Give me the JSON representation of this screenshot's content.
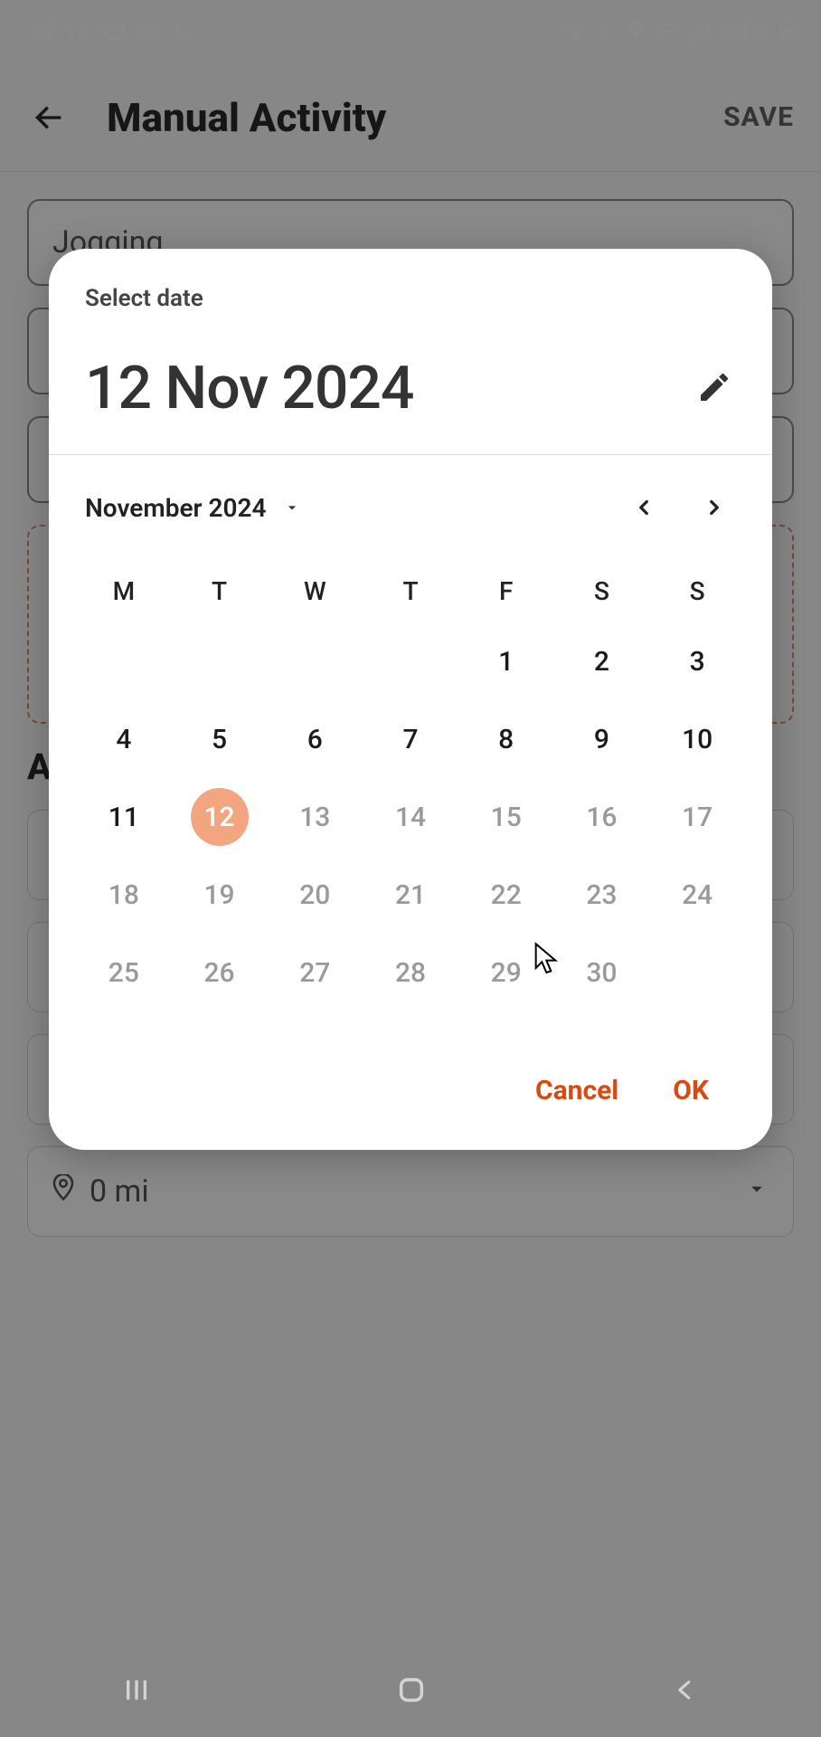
{
  "statusbar": {
    "time": "12:16",
    "battery": "54%"
  },
  "appbar": {
    "title": "Manual Activity",
    "save": "SAVE"
  },
  "form": {
    "activity_name": "Jogging",
    "section_label": "A",
    "distance": "0 mi"
  },
  "datepicker": {
    "label": "Select date",
    "selected_display": "12 Nov 2024",
    "month_label": "November 2024",
    "weekdays": [
      "M",
      "T",
      "W",
      "T",
      "F",
      "S",
      "S"
    ],
    "selected_day": 12,
    "today_day": 12,
    "first_weekday_index": 4,
    "days_in_month": 30,
    "actions": {
      "cancel": "Cancel",
      "ok": "OK"
    }
  }
}
